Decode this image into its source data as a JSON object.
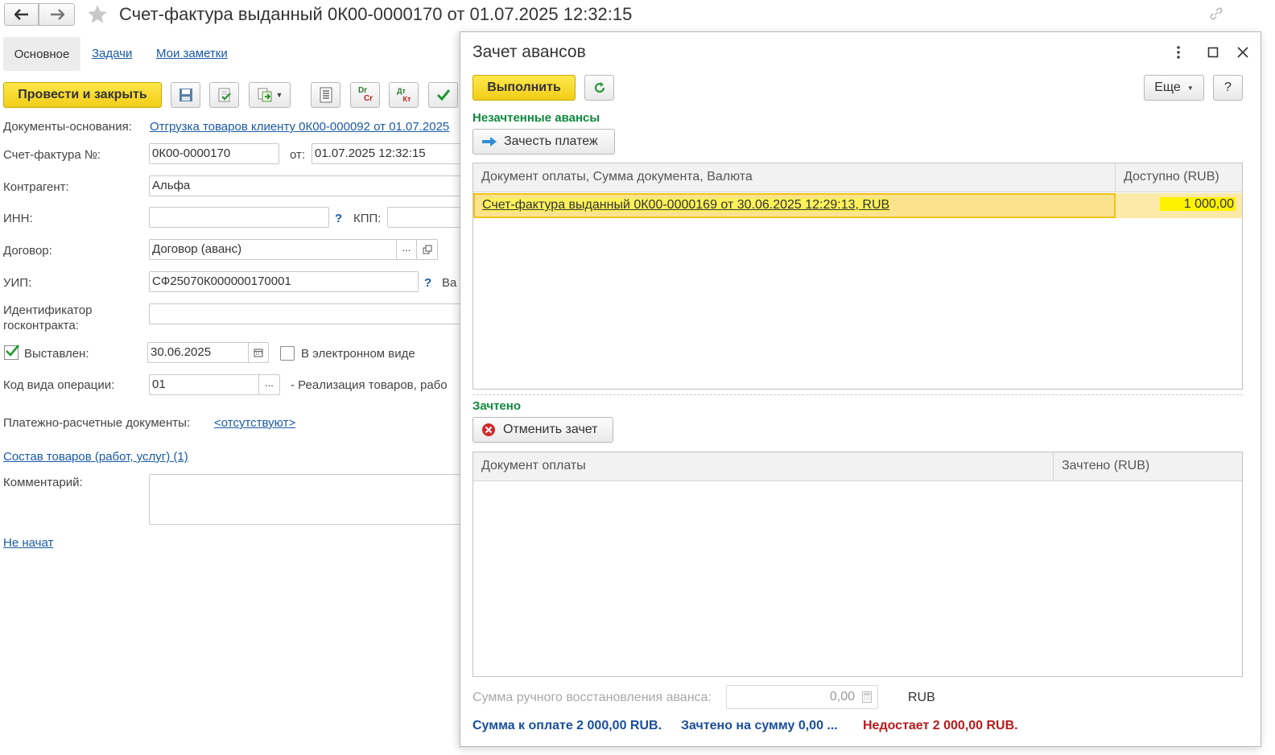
{
  "window": {
    "title": "Счет-фактура выданный 0К00-0000170 от 01.07.2025 12:32:15"
  },
  "tabs": [
    {
      "label": "Основное",
      "active": true
    },
    {
      "label": "Задачи"
    },
    {
      "label": "Мои заметки"
    }
  ],
  "toolbar": {
    "post_close_label": "Провести и закрыть",
    "dt_label_top": "Dr",
    "dt_label_bottom": "Cr",
    "dtkt_top": "Дт",
    "dtkt_bottom": "Кт"
  },
  "form": {
    "base_docs_label": "Документы-основания:",
    "base_docs_value": "Отгрузка товаров клиенту 0К00-000092 от 01.07.2025",
    "invoice_no_label": "Счет-фактура №:",
    "invoice_no_value": "0К00-0000170",
    "from_label": "от:",
    "from_value": "01.07.2025 12:32:15",
    "counterparty_label": "Контрагент:",
    "counterparty_value": "Альфа",
    "inn_label": "ИНН:",
    "inn_value": "",
    "question_mark": "?",
    "kpp_label": "КПП:",
    "contract_label": "Договор:",
    "contract_value": "Договор (аванс)",
    "dots": "...",
    "uip_label": "УИП:",
    "uip_value": "СФ25070К000000170001",
    "uip_tail": "Ва",
    "gov_id_label_1": "Идентификатор",
    "gov_id_label_2": "госконтракта:",
    "issued_label": "Выставлен:",
    "issued_value": "30.06.2025",
    "electronic_label": "В электронном виде",
    "op_code_label": "Код вида операции:",
    "op_code_value": "01",
    "op_code_desc": "- Реализация товаров, рабо",
    "payment_docs_label": "Платежно-расчетные документы:",
    "payment_docs_value": "<отсутствуют>",
    "goods_link": "Состав товаров (работ, услуг) (1)",
    "comment_label": "Комментарий:",
    "status_link": "Не начат"
  },
  "dialog": {
    "title": "Зачет авансов",
    "execute_label": "Выполнить",
    "more_label": "Еще",
    "help_label": "?",
    "unoffset_heading": "Незачтенные авансы",
    "offset_payment_label": "Зачесть платеж",
    "table1": {
      "col1": "Документ оплаты, Сумма документа, Валюта",
      "col2": "Доступно (RUB)",
      "rows": [
        {
          "doc": "Счет-фактура выданный 0К00-0000169 от 30.06.2025 12:29:13, RUB",
          "available": "1 000,00"
        }
      ]
    },
    "offset_heading": "Зачтено",
    "cancel_offset_label": "Отменить зачет",
    "table2": {
      "col1": "Документ оплаты",
      "col2": "Зачтено (RUB)"
    },
    "manual_restore_label": "Сумма ручного восстановления аванса:",
    "manual_restore_value": "0,00",
    "currency": "RUB",
    "summary_to_pay": "Сумма к оплате 2 000,00 RUB.",
    "summary_offset": "Зачтено на сумму 0,00 ...",
    "summary_missing": "Недостает 2 000,00 RUB."
  },
  "colors": {
    "accent_yellow": "#f5d21e",
    "row_highlight": "#fbe38e",
    "link_blue": "#1a5aa8",
    "heading_green": "#0e8a3c",
    "error_red": "#b81b1b"
  }
}
